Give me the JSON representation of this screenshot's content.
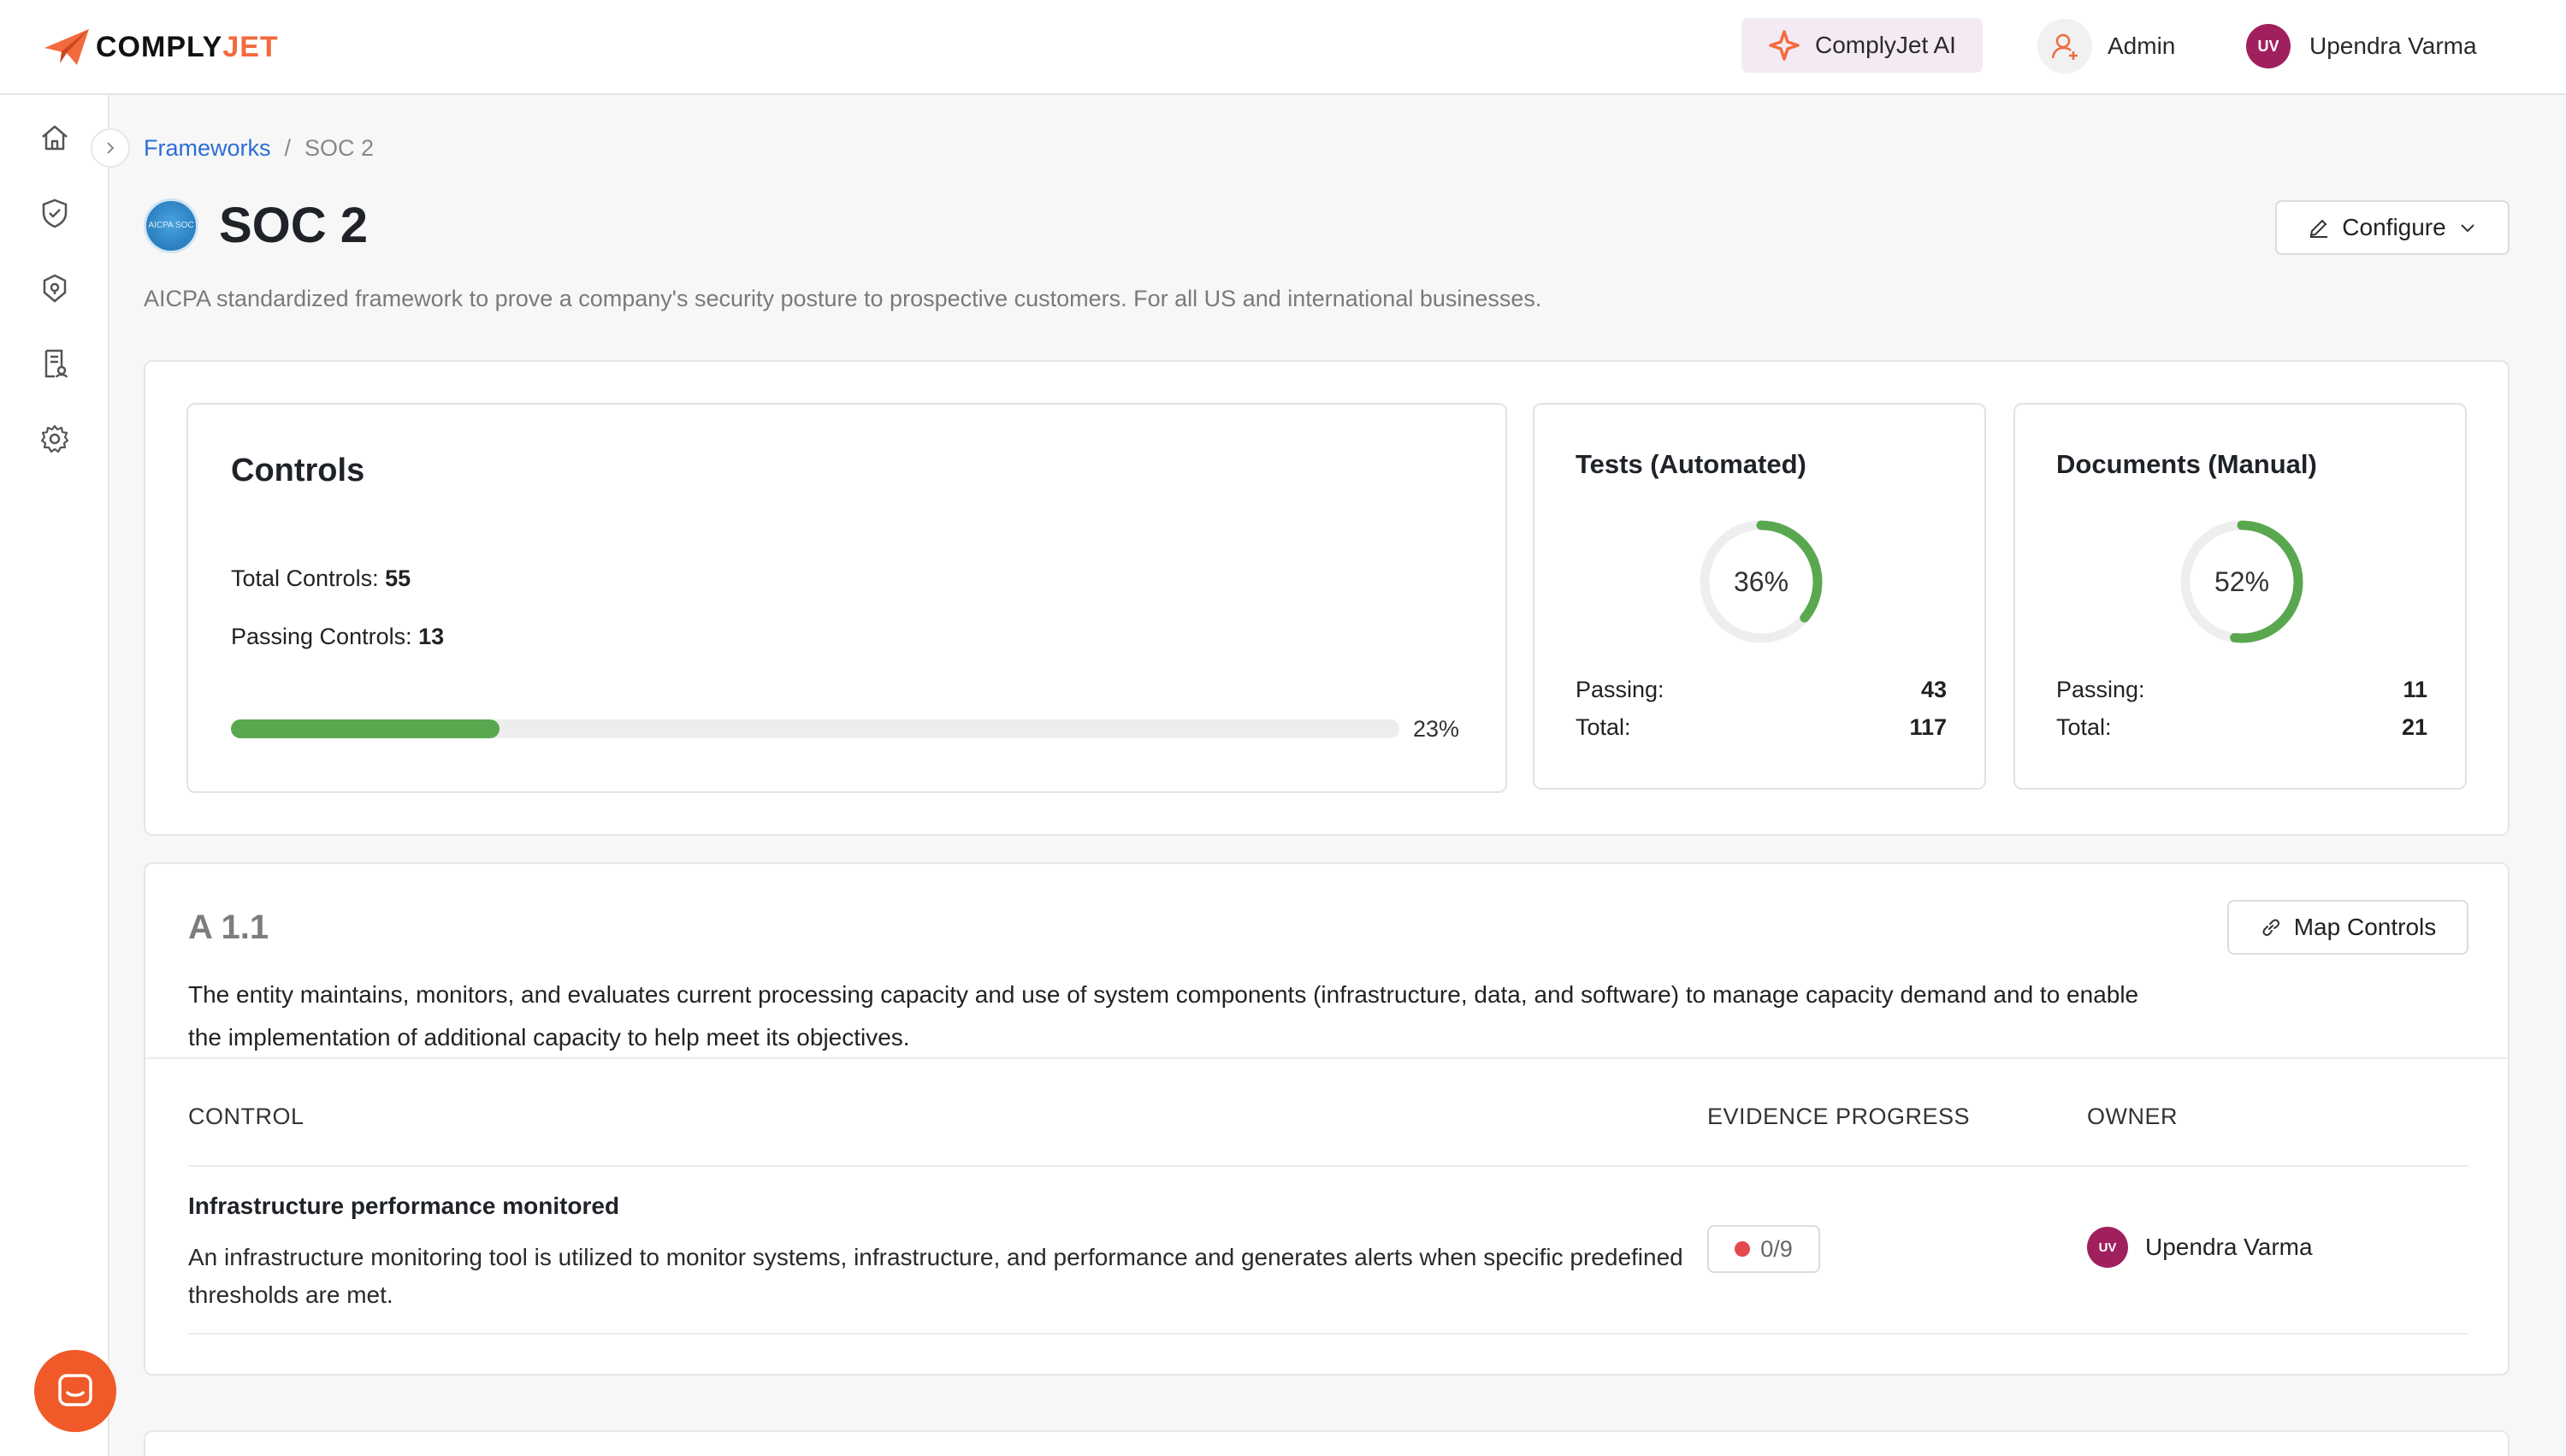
{
  "header": {
    "logo_main": "COMPLY",
    "logo_accent": "JET",
    "ai_button": "ComplyJet AI",
    "admin_label": "Admin",
    "user_initials": "UV",
    "user_name": "Upendra Varma"
  },
  "breadcrumb": {
    "parent": "Frameworks",
    "separator": "/",
    "current": "SOC 2"
  },
  "page": {
    "title": "SOC 2",
    "framework_logo_text": "AICPA SOC",
    "subtitle": "AICPA standardized framework to prove a company's security posture to prospective customers. For all US and international businesses.",
    "configure_label": "Configure"
  },
  "controls_card": {
    "title": "Controls",
    "total_label": "Total Controls:",
    "total_value": "55",
    "passing_label": "Passing Controls:",
    "passing_value": "13",
    "progress_pct": 23,
    "progress_label": "23%"
  },
  "tests_card": {
    "title": "Tests (Automated)",
    "pct": 36,
    "pct_label": "36%",
    "passing_label": "Passing:",
    "passing_value": "43",
    "total_label": "Total:",
    "total_value": "117"
  },
  "docs_card": {
    "title": "Documents (Manual)",
    "pct": 52,
    "pct_label": "52%",
    "passing_label": "Passing:",
    "passing_value": "11",
    "total_label": "Total:",
    "total_value": "21"
  },
  "requirement": {
    "id": "A 1.1",
    "map_button": "Map Controls",
    "description": "The entity maintains, monitors, and evaluates current processing capacity and use of system components (infrastructure, data, and software) to manage capacity demand and to enable the implementation of additional capacity to help meet its objectives.",
    "columns": [
      "CONTROL",
      "EVIDENCE PROGRESS",
      "OWNER"
    ],
    "rows": [
      {
        "name": "Infrastructure performance monitored",
        "description": "An infrastructure monitoring tool is utilized to monitor systems, infrastructure, and performance and generates alerts when specific predefined thresholds are met.",
        "evidence": "0/9",
        "owner_initials": "UV",
        "owner_name": "Upendra Varma"
      }
    ]
  },
  "colors": {
    "brand": "#f26a3d",
    "success": "#59a84f",
    "danger": "#e5484d",
    "avatar": "#a0205e",
    "link": "#2c6ed5"
  }
}
